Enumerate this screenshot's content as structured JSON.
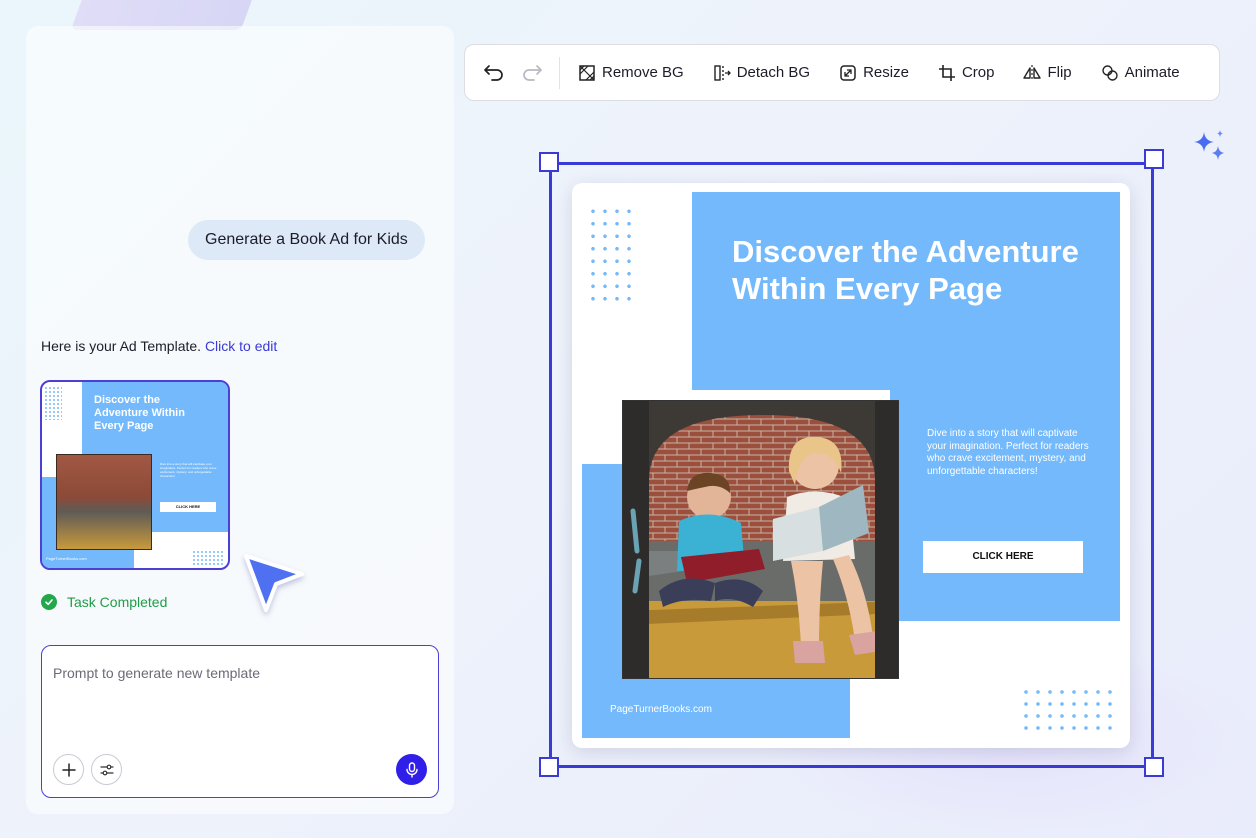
{
  "chat": {
    "user_message": "Generate a Book Ad for Kids",
    "response_text": "Here is your Ad Template. ",
    "response_link": "Click to edit",
    "status": "Task Completed"
  },
  "prompt": {
    "placeholder": "Prompt to generate new template"
  },
  "toolbar": {
    "remove_bg": "Remove BG",
    "detach_bg": "Detach BG",
    "resize": "Resize",
    "crop": "Crop",
    "flip": "Flip",
    "animate": "Animate"
  },
  "ad": {
    "title": "Discover the Adventure Within Every Page",
    "body": "Dive into a story that will captivate your imagination. Perfect for readers who crave excitement, mystery, and unforgettable characters!",
    "cta": "CLICK HERE",
    "url": "PageTurnerBooks.com"
  },
  "colors": {
    "accent": "#3a3ad6",
    "ad_blue": "#73b9fb",
    "success": "#22a84a",
    "mic": "#2f1fe8"
  }
}
